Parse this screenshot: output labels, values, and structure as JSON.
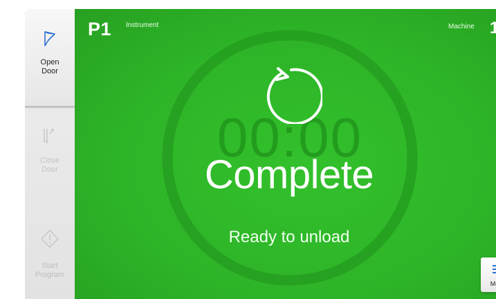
{
  "sidebar": {
    "open_door": {
      "label": "Open\nDoor",
      "icon": "open-door-icon"
    },
    "close_door": {
      "label": "Close\nDoor",
      "icon": "close-door-icon"
    },
    "start_program": {
      "label": "Start\nProgram",
      "icon": "start-program-icon"
    }
  },
  "header": {
    "program": "P1",
    "instrument_label": "Instrument",
    "machine_label": "Machine",
    "machine_number": "1"
  },
  "status": {
    "timer": "00:00",
    "title": "Complete",
    "subtitle": "Ready to unload",
    "icon": "restart-icon"
  },
  "menu": {
    "label": "Menu",
    "icon": "hamburger-icon"
  },
  "colors": {
    "background_green": "#2fb12a",
    "ring_green": "#259d20",
    "accent_blue": "#2d6fd1",
    "sidebar_gray": "#e6e6e6"
  }
}
